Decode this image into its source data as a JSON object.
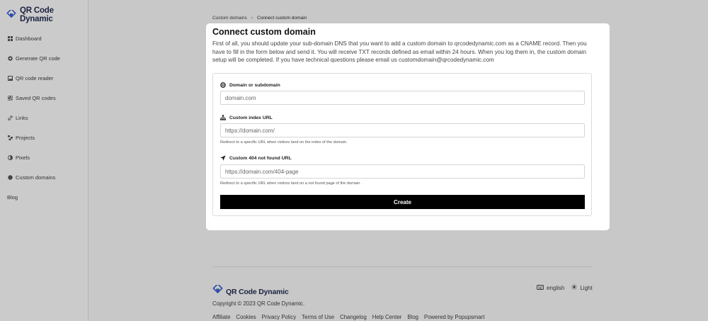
{
  "brand": {
    "name": "QR Code Dynamic",
    "accent": "#2f4fa8"
  },
  "sidebar": {
    "items": [
      {
        "label": "Dashboard",
        "icon": "grid-icon"
      },
      {
        "label": "Generate QR code",
        "icon": "plus-circle-icon"
      },
      {
        "label": "QR code reader",
        "icon": "image-icon"
      },
      {
        "label": "Saved QR codes",
        "icon": "qr-icon"
      },
      {
        "label": "Links",
        "icon": "link-icon"
      },
      {
        "label": "Projects",
        "icon": "project-icon"
      },
      {
        "label": "Pixels",
        "icon": "pixel-icon"
      },
      {
        "label": "Custom domains",
        "icon": "globe-icon"
      },
      {
        "label": "Blog",
        "icon": ""
      }
    ]
  },
  "breadcrumb": {
    "parent": "Custom domains",
    "separator": "›",
    "current": "Connect custom domain"
  },
  "modal": {
    "title": "Connect custom domain",
    "description": "First of all, you should update your sub-domain DNS that you want to add a custom domain to qrcodedynamic.com as a CNAME record. Then you have to fill in the form below and send it. You will receive TXT records defined as email within 24 hours. When you log them in, the custom domain setup will be completed. If you have technical questions please email us customdomain@qrcodedynamic.com",
    "fields": {
      "domain": {
        "label": "Domain or subdomain",
        "placeholder": "domain.com"
      },
      "index_url": {
        "label": "Custom index URL",
        "placeholder": "https://domain.com/",
        "help": "Redirect to a specific URL when visitors land on the index of the domain."
      },
      "notfound_url": {
        "label": "Custom 404 not found URL",
        "placeholder": "https://domain.com/404-page",
        "help": "Redirect to a specific URL when visitors land on a not found page of the domain."
      }
    },
    "submit_label": "Create"
  },
  "footer": {
    "language": "english",
    "theme": "Light",
    "copyright": "Copyright © 2023 QR Code Dynamic.",
    "links": [
      "Affiliate",
      "Cookies",
      "Privacy Policy",
      "Terms of Use",
      "Changelog",
      "Help Center",
      "Blog",
      "Powered by Popupsmart"
    ]
  }
}
